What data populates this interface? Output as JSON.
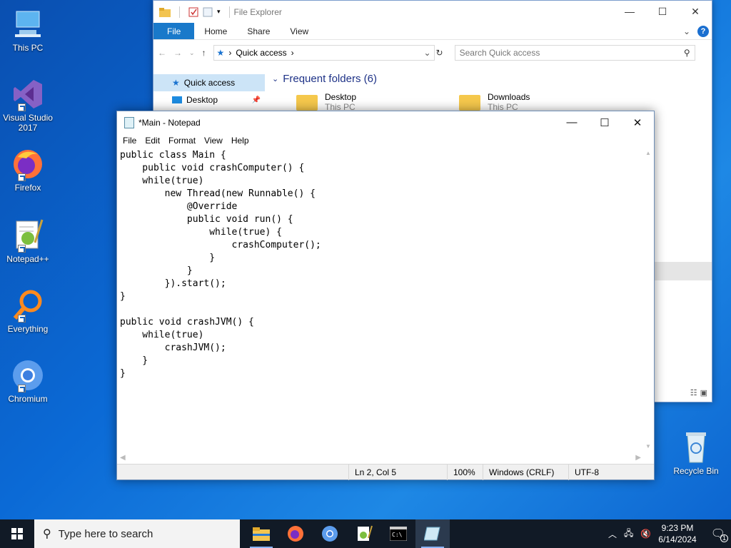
{
  "desktop": {
    "icons": [
      {
        "label": "This PC"
      },
      {
        "label": "Visual Studio 2017"
      },
      {
        "label": "Firefox"
      },
      {
        "label": "Notepad++"
      },
      {
        "label": "Everything"
      },
      {
        "label": "Chromium"
      }
    ],
    "recycle_bin": "Recycle Bin"
  },
  "explorer": {
    "title": "File Explorer",
    "tabs": [
      "File",
      "Home",
      "Share",
      "View"
    ],
    "address": "Quick access",
    "search_placeholder": "Search Quick access",
    "nav_items": [
      "Quick access",
      "Desktop"
    ],
    "frequent_header": "Frequent folders (6)",
    "folders": [
      {
        "name": "Desktop",
        "sub": "This PC"
      },
      {
        "name": "Downloads",
        "sub": "This PC"
      }
    ]
  },
  "notepad": {
    "title": "*Main - Notepad",
    "menu": [
      "File",
      "Edit",
      "Format",
      "View",
      "Help"
    ],
    "content": "public class Main {\n    public void crashComputer() {\n    while(true)\n        new Thread(new Runnable() {\n            @Override\n            public void run() {\n                while(true) {\n                    crashComputer();\n                }\n            }\n        }).start();\n}\n\npublic void crashJVM() {\n    while(true)\n        crashJVM();\n    }\n}",
    "status": {
      "position": "Ln 2, Col 5",
      "zoom": "100%",
      "line_endings": "Windows (CRLF)",
      "encoding": "UTF-8"
    }
  },
  "taskbar": {
    "search_placeholder": "Type here to search",
    "time": "9:23 PM",
    "date": "6/14/2024",
    "notification_count": "1"
  }
}
